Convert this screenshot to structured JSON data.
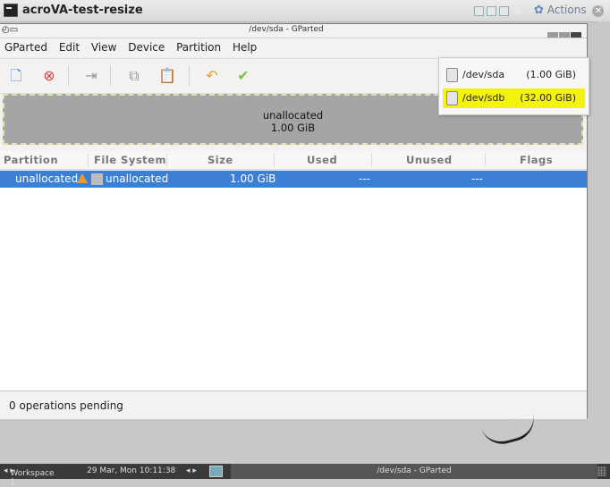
{
  "vm": {
    "title": "acroVA-test-resize",
    "actions_label": "Actions"
  },
  "window": {
    "title": "/dev/sda - GParted"
  },
  "menu": [
    "GParted",
    "Edit",
    "View",
    "Device",
    "Partition",
    "Help"
  ],
  "toolbar": {
    "icons": [
      "new-icon",
      "delete-icon",
      "resize-move-icon",
      "copy-icon",
      "paste-icon",
      "undo-icon",
      "apply-icon"
    ]
  },
  "graph": {
    "label": "unallocated",
    "size": "1.00 GiB"
  },
  "table": {
    "headers": [
      "Partition",
      "File System",
      "Size",
      "Used",
      "Unused",
      "Flags"
    ],
    "rows": [
      {
        "partition": "unallocated",
        "filesystem": "unallocated",
        "size": "1.00 GiB",
        "used": "---",
        "unused": "---",
        "flags": ""
      }
    ]
  },
  "status": {
    "text": "0 operations pending"
  },
  "devices": [
    {
      "name": "/dev/sda",
      "size": "(1.00 GiB)"
    },
    {
      "name": "/dev/sdb",
      "size": "(32.00 GiB)"
    }
  ],
  "taskbar": {
    "workspace": "Workspace 1",
    "datetime": "29 Mar, Mon 10:11:38",
    "task_title": "/dev/sda - GParted"
  },
  "colors": {
    "selection": "#3b80d6",
    "highlight": "#f4f30d",
    "unallocated": "#a5a5a5"
  }
}
